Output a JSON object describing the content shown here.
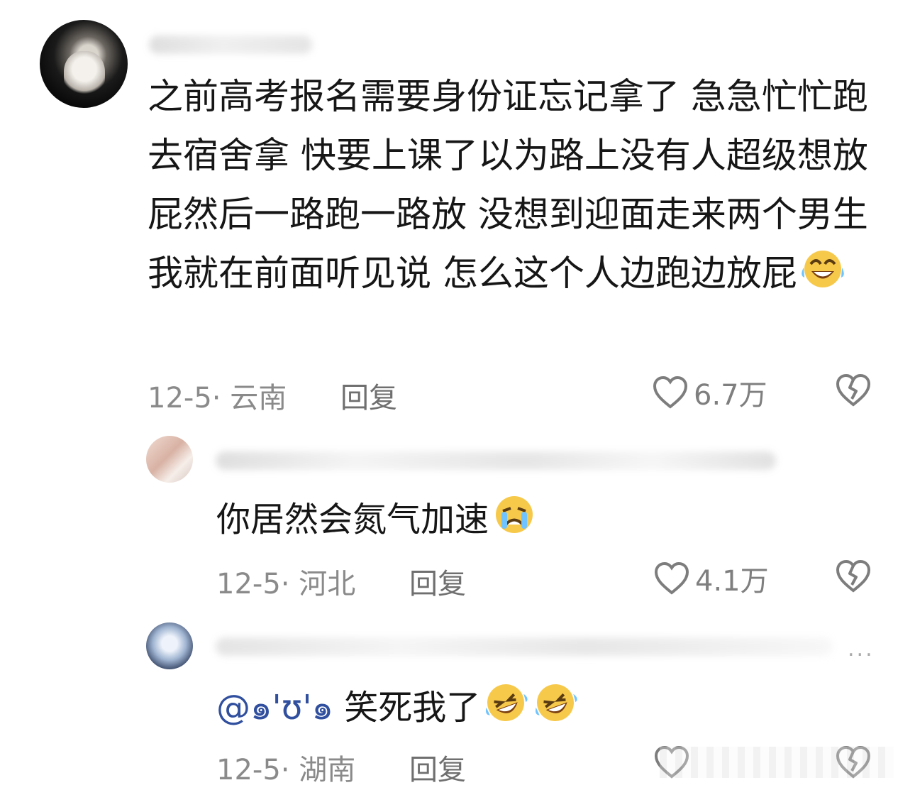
{
  "comments": [
    {
      "text": "之前高考报名需要身份证忘记拿了 急急忙忙跑去宿舍拿 快要上课了以为路上没有人超级想放屁然后一路跑一路放 没想到迎面走来两个男生 我就在前面听见说 怎么这个人边跑边放屁",
      "emoji": "laughing-tears-emoji",
      "meta": "12-5· 云南",
      "reply": "回复",
      "likes": "6.7万"
    },
    {
      "text": "你居然会氮气加速",
      "emoji": "crying-emoji",
      "meta": "12-5· 河北",
      "reply": "回复",
      "likes": "4.1万"
    },
    {
      "mention": "@๑'ʊ'๑",
      "text": " 笑死我了",
      "emoji": "rolling-laughing-emoji",
      "meta": "12-5· 湖南",
      "reply": "回复",
      "likes": "",
      "more": "..."
    }
  ],
  "colors": {
    "text": "#161616",
    "meta": "#8a8a8a",
    "mention": "#304f9e",
    "background": "#ffffff"
  }
}
